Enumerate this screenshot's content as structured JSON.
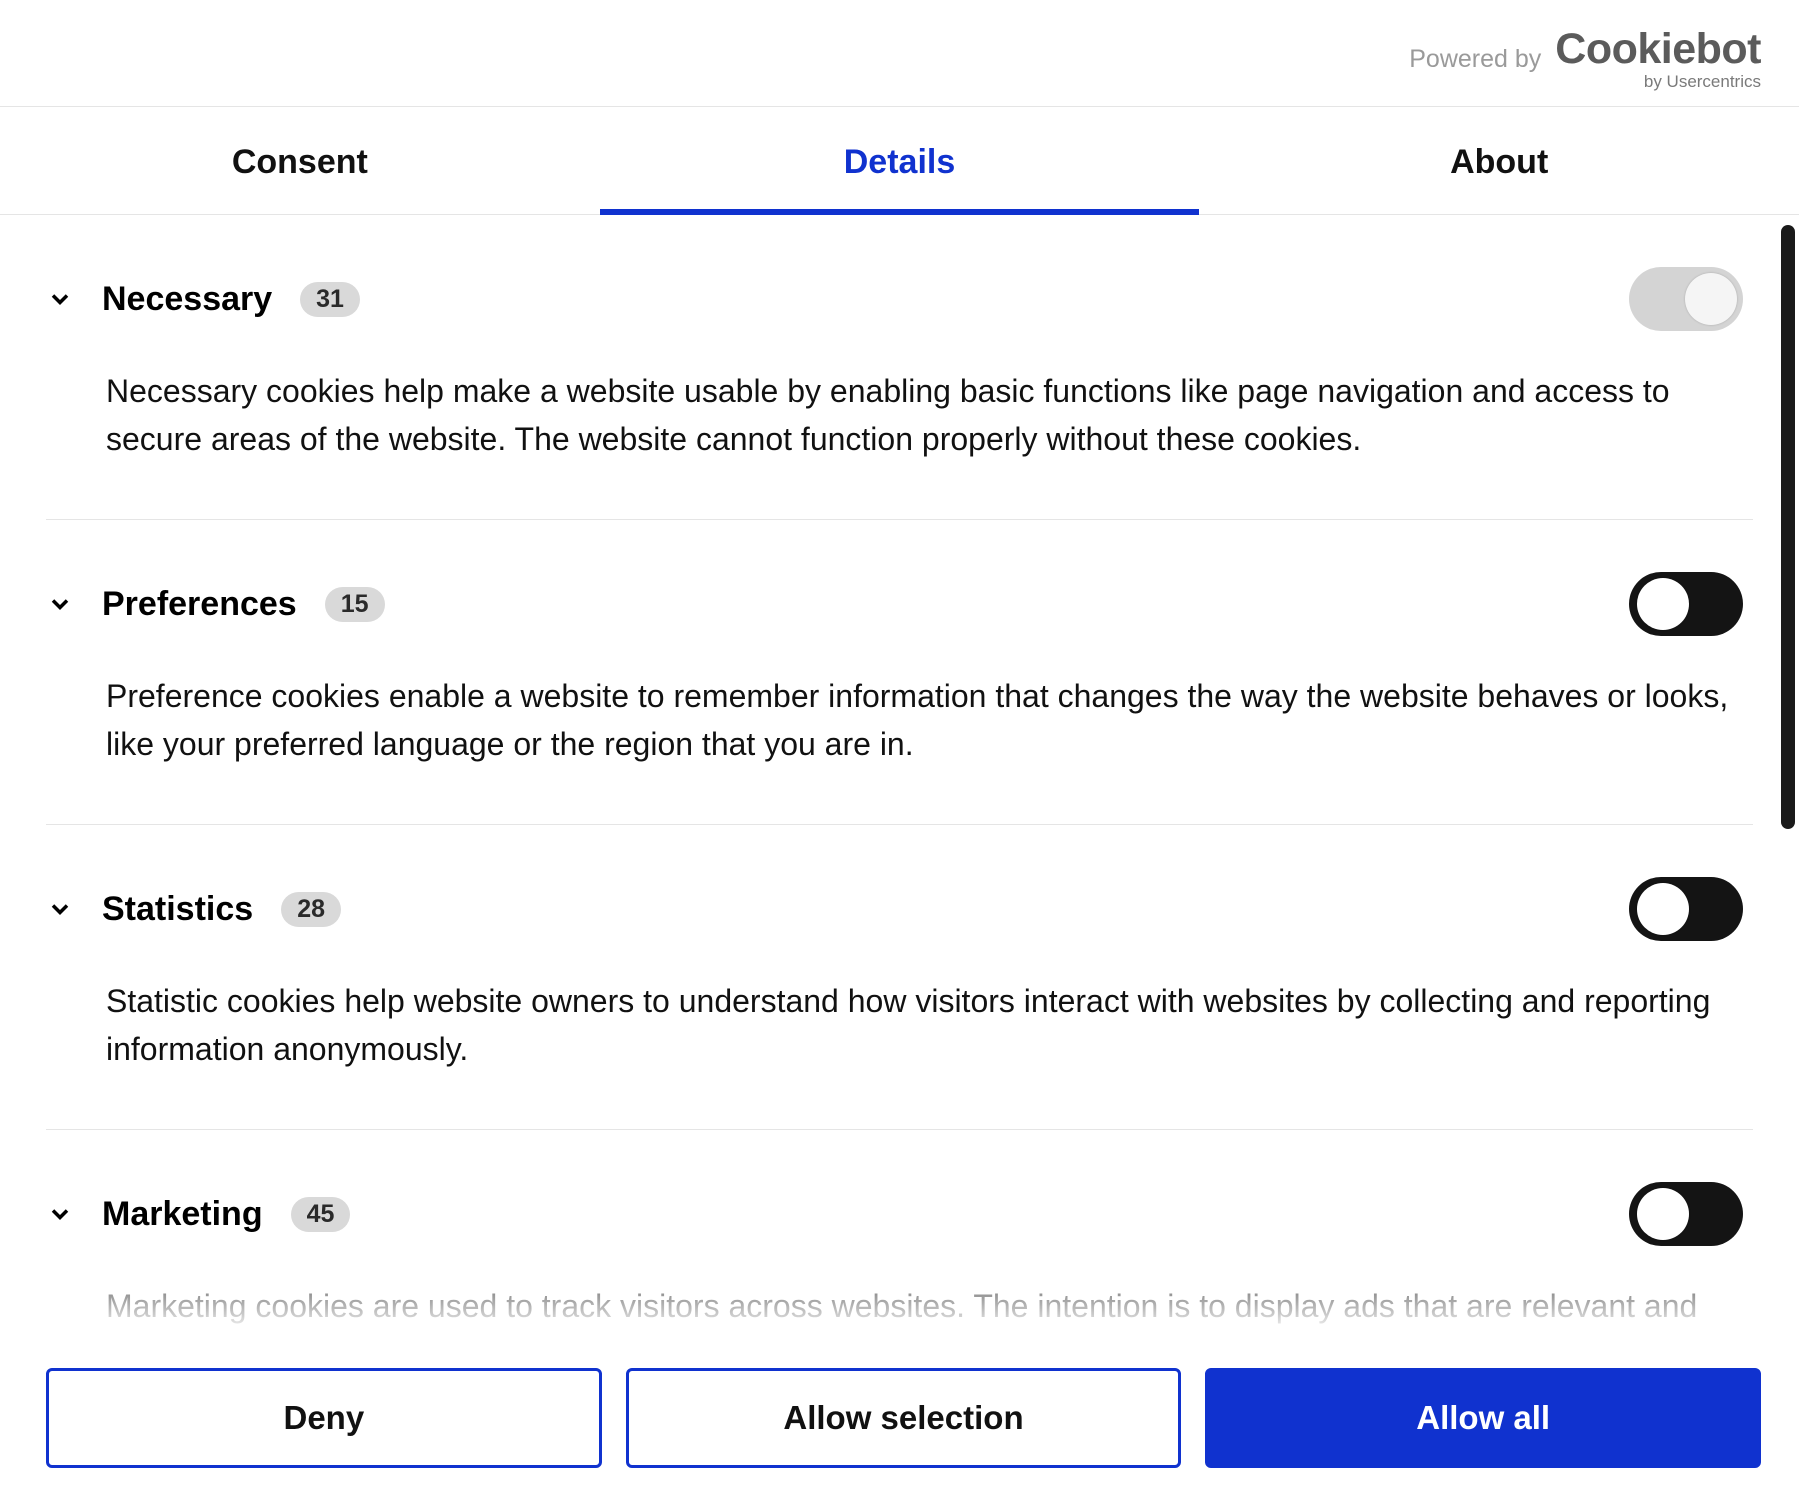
{
  "header": {
    "powered_by": "Powered by",
    "brand": "Cookiebot",
    "subbrand": "by Usercentrics"
  },
  "tabs": {
    "consent": "Consent",
    "details": "Details",
    "about": "About",
    "active": "details"
  },
  "categories": [
    {
      "id": "necessary",
      "title": "Necessary",
      "count": "31",
      "description": "Necessary cookies help make a website usable by enabling basic functions like page navigation and access to secure areas of the website. The website cannot function properly without these cookies.",
      "toggle": "disabled"
    },
    {
      "id": "preferences",
      "title": "Preferences",
      "count": "15",
      "description": "Preference cookies enable a website to remember information that changes the way the website behaves or looks, like your preferred language or the region that you are in.",
      "toggle": "on"
    },
    {
      "id": "statistics",
      "title": "Statistics",
      "count": "28",
      "description": "Statistic cookies help website owners to understand how visitors interact with websites by collecting and reporting information anonymously.",
      "toggle": "on"
    },
    {
      "id": "marketing",
      "title": "Marketing",
      "count": "45",
      "description": "Marketing cookies are used to track visitors across websites. The intention is to display ads that are relevant and engaging for the individual user and thereby more valuable for publishers and third party advertisers.",
      "toggle": "on"
    }
  ],
  "footer": {
    "deny": "Deny",
    "allow_selection": "Allow selection",
    "allow_all": "Allow all"
  }
}
